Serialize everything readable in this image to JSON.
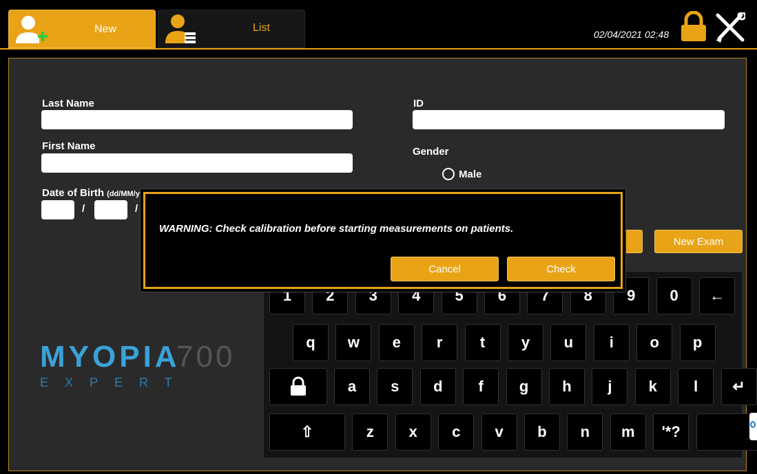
{
  "header": {
    "tabs": [
      {
        "label": "New",
        "icon": "add-user-icon",
        "active": true
      },
      {
        "label": "List",
        "icon": "user-list-icon",
        "active": false
      }
    ],
    "datetime": "02/04/2021 02:48"
  },
  "form": {
    "last_name_label": "Last Name",
    "first_name_label": "First Name",
    "dob_label": "Date of Birth",
    "dob_format": "(dd/MM/yyyy)",
    "dob_separator": "/",
    "id_label": "ID",
    "gender_label": "Gender",
    "gender_options": [
      "Male"
    ],
    "new_exam_label": "New Exam"
  },
  "logo": {
    "brand": "MYOPIA",
    "model": "700",
    "tagline": "EXPERT"
  },
  "dialog": {
    "message": "WARNING: Check calibration before starting measurements on patients.",
    "cancel_label": "Cancel",
    "check_label": "Check"
  },
  "keyboard": {
    "row1": [
      "1",
      "2",
      "3",
      "4",
      "5",
      "6",
      "7",
      "8",
      "9",
      "0",
      "←"
    ],
    "row2": [
      "q",
      "w",
      "e",
      "r",
      "t",
      "y",
      "u",
      "i",
      "o",
      "p"
    ],
    "row3": [
      "a",
      "s",
      "d",
      "f",
      "g",
      "h",
      "j",
      "k",
      "l",
      "↵"
    ],
    "row4": [
      "⇧",
      "z",
      "x",
      "c",
      "v",
      "b",
      "n",
      "m",
      "'*?",
      ""
    ]
  },
  "colors": {
    "accent": "#E8A317",
    "panel": "#2a2a2a",
    "logo_blue": "#3aa2d9"
  }
}
